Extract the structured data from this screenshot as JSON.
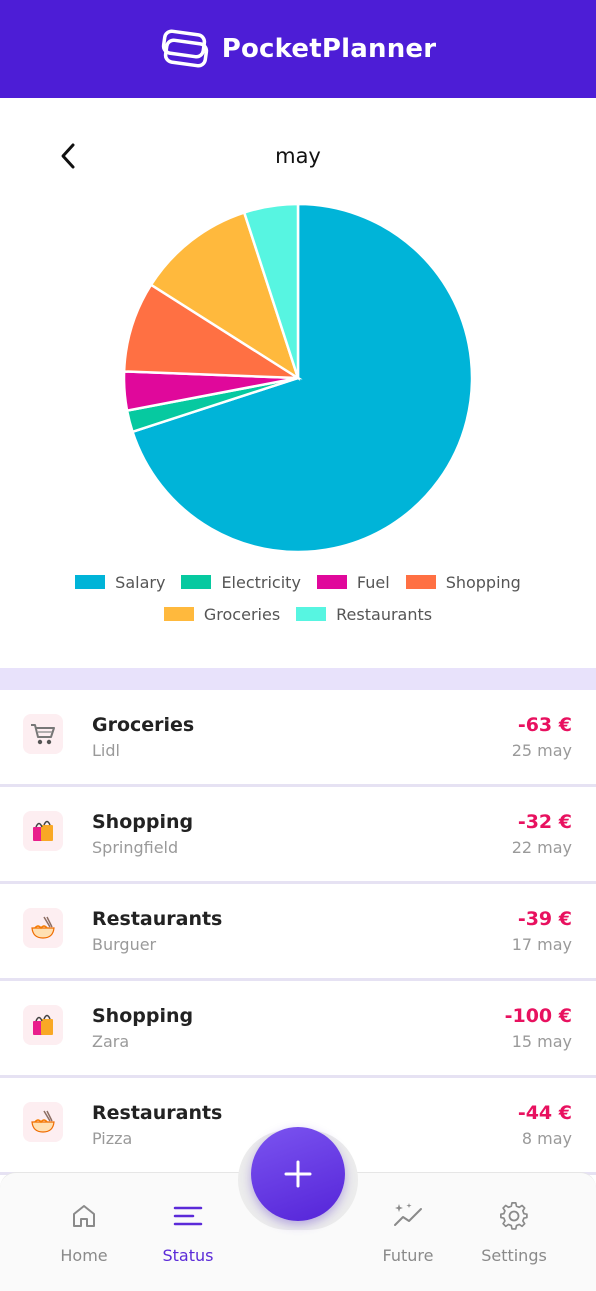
{
  "header": {
    "app_name": "PocketPlanner"
  },
  "month": {
    "title": "may"
  },
  "chart_data": {
    "type": "pie",
    "title": "",
    "slices": [
      {
        "label": "Salary",
        "value": 70.0,
        "color": "#00b4d8"
      },
      {
        "label": "Electricity",
        "value": 2.0,
        "color": "#06c9a0"
      },
      {
        "label": "Fuel",
        "value": 3.6,
        "color": "#e0089b"
      },
      {
        "label": "Shopping",
        "value": 8.4,
        "color": "#ff7043"
      },
      {
        "label": "Groceries",
        "value": 11.0,
        "color": "#ffb93d"
      },
      {
        "label": "Restaurants",
        "value": 5.0,
        "color": "#57f5e1"
      }
    ],
    "legend": "bottom"
  },
  "transactions": [
    {
      "category": "Groceries",
      "place": "Lidl",
      "amount": "-63 €",
      "date": "25 may",
      "icon": "shopping-cart-icon"
    },
    {
      "category": "Shopping",
      "place": "Springfield",
      "amount": "-32 €",
      "date": "22 may",
      "icon": "shopping-bags-icon"
    },
    {
      "category": "Restaurants",
      "place": "Burguer",
      "amount": "-39 €",
      "date": "17 may",
      "icon": "noodle-bowl-icon"
    },
    {
      "category": "Shopping",
      "place": "Zara",
      "amount": "-100 €",
      "date": "15 may",
      "icon": "shopping-bags-icon"
    },
    {
      "category": "Restaurants",
      "place": "Pizza",
      "amount": "-44 €",
      "date": "8 may",
      "icon": "noodle-bowl-icon"
    }
  ],
  "nav": {
    "home": "Home",
    "status": "Status",
    "future": "Future",
    "settings": "Settings",
    "active": "status"
  },
  "colors": {
    "brand": "#4d1dd6",
    "accent": "#5b2ad8",
    "negative": "#e8115f"
  }
}
